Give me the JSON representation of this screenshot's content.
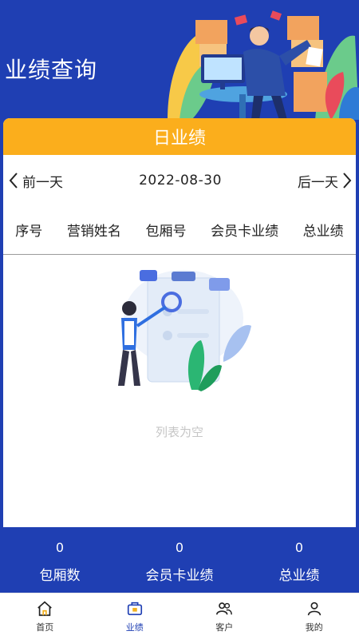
{
  "header": {
    "title": "业绩查询"
  },
  "card": {
    "title": "日业绩",
    "prev_label": "前一天",
    "next_label": "后一天",
    "date": "2022-08-30"
  },
  "table": {
    "columns": [
      "序号",
      "营销姓名",
      "包厢号",
      "会员卡业绩",
      "总业绩"
    ]
  },
  "empty": {
    "text": "列表为空"
  },
  "stats": [
    {
      "value": "0",
      "label": "包厢数"
    },
    {
      "value": "0",
      "label": "会员卡业绩"
    },
    {
      "value": "0",
      "label": "总业绩"
    }
  ],
  "tabs": [
    {
      "label": "首页",
      "icon": "home-icon"
    },
    {
      "label": "业绩",
      "icon": "performance-icon",
      "active": true
    },
    {
      "label": "客户",
      "icon": "customers-icon"
    },
    {
      "label": "我的",
      "icon": "profile-icon"
    }
  ],
  "colors": {
    "primary": "#1F3FB3",
    "accent": "#FBAE1C",
    "empty_text": "#C6C6C6"
  }
}
